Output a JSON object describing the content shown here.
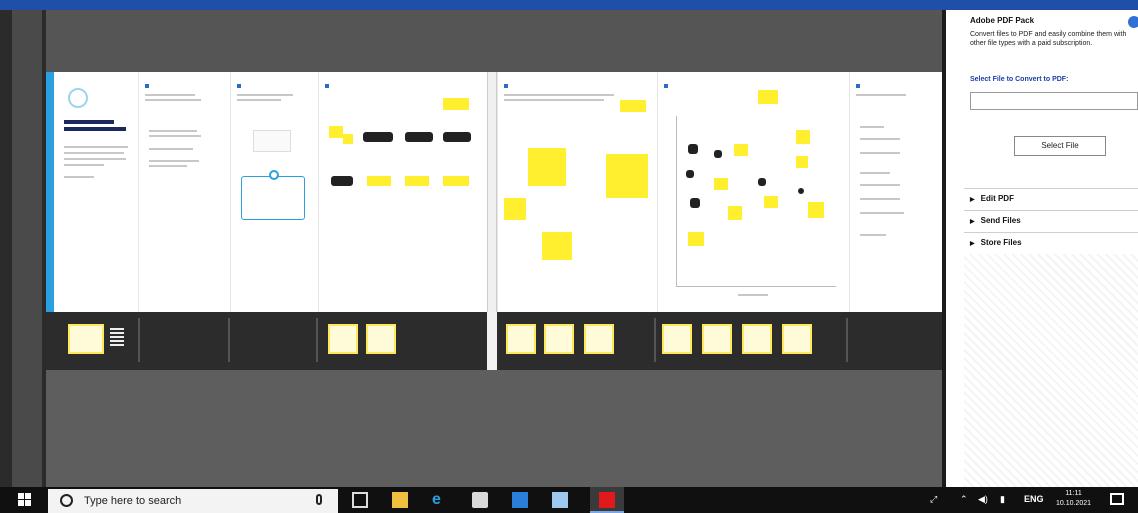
{
  "taskbar": {
    "search_placeholder": "Type here to search",
    "language": "ENG",
    "time": "11:11",
    "date": "10.10.2021"
  },
  "pdf_panel": {
    "title": "Adobe PDF Pack",
    "description": "Convert files to PDF and easily combine them with other file types with a paid subscription.",
    "select_label": "Select File to Convert to PDF:",
    "file_input_value": "",
    "select_button": "Select File",
    "sections": [
      "Edit PDF",
      "Send Files",
      "Store Files"
    ]
  },
  "colors": {
    "accent_blue": "#2aa0e0",
    "sticky_yellow": "#ffef2e",
    "adobe_red": "#e0191b",
    "link_blue": "#1c3fa6"
  },
  "icons": [
    "windows-start-icon",
    "search-icon",
    "microphone-icon",
    "task-view-icon",
    "file-explorer-icon",
    "edge-icon",
    "store-icon",
    "mail-icon",
    "notepad-icon",
    "adobe-reader-icon",
    "network-icon",
    "chevron-up-icon",
    "speaker-icon",
    "notification-icon"
  ]
}
